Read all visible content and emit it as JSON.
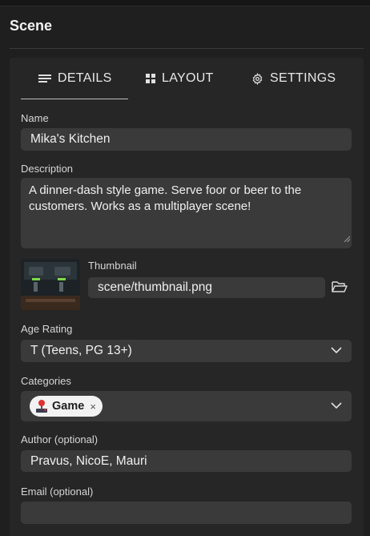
{
  "panel": {
    "title": "Scene"
  },
  "tabs": [
    {
      "label": "DETAILS",
      "icon": "lines-icon",
      "active": true
    },
    {
      "label": "LAYOUT",
      "icon": "grid-icon",
      "active": false
    },
    {
      "label": "SETTINGS",
      "icon": "gear-icon",
      "active": false
    }
  ],
  "form": {
    "name": {
      "label": "Name",
      "value": "Mika's Kitchen"
    },
    "description": {
      "label": "Description",
      "value": "A dinner-dash style game. Serve foor or beer to the customers. Works as a multiplayer scene!"
    },
    "thumbnail": {
      "label": "Thumbnail",
      "value": "scene/thumbnail.png",
      "browse_icon": "folder-open-icon"
    },
    "age_rating": {
      "label": "Age Rating",
      "value": "T (Teens, PG 13+)"
    },
    "categories": {
      "label": "Categories",
      "chips": [
        {
          "label": "Game",
          "icon": "joystick-icon"
        }
      ]
    },
    "author": {
      "label": "Author (optional)",
      "value": "Pravus, NicoE, Mauri"
    },
    "email": {
      "label": "Email (optional)",
      "value": ""
    }
  }
}
